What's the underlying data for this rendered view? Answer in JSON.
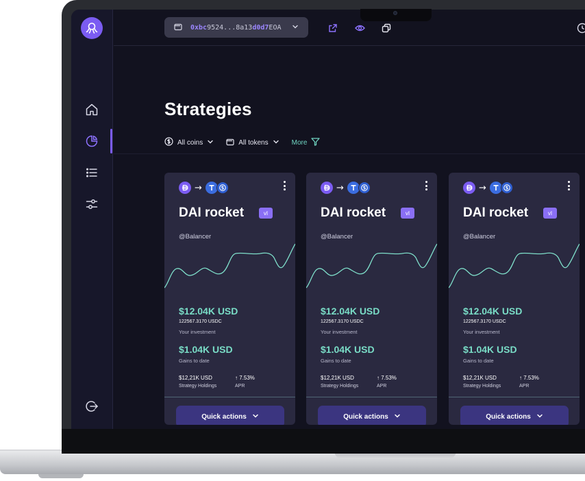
{
  "wallet": {
    "address_prefix": "0xbc",
    "address_middle": "9524...8a13",
    "address_accent": "d0d7",
    "address_suffix": "EOA"
  },
  "page": {
    "title": "Strategies"
  },
  "filters": {
    "coins_label": "All coins",
    "tokens_label": "All tokens",
    "more_label": "More"
  },
  "cards": [
    {
      "title": "DAI rocket",
      "version": "vI",
      "handle": "@Balancer",
      "investment_usd": "$12.04K USD",
      "investment_usdc": "122567.3170 USDC",
      "investment_label": "Your investment",
      "gains_usd": "$1.04K USD",
      "gains_label": "Gains to date",
      "holdings_value": "$12,21K USD",
      "holdings_label": "Strategy Holdings",
      "apr_value": "↑ 7.53%",
      "apr_label": "APR",
      "action_label": "Quick actions"
    },
    {
      "title": "DAI rocket",
      "version": "vI",
      "handle": "@Balancer",
      "investment_usd": "$12.04K USD",
      "investment_usdc": "122567.3170 USDC",
      "investment_label": "Your investment",
      "gains_usd": "$1.04K USD",
      "gains_label": "Gains to date",
      "holdings_value": "$12,21K USD",
      "holdings_label": "Strategy Holdings",
      "apr_value": "↑ 7.53%",
      "apr_label": "APR",
      "action_label": "Quick actions"
    },
    {
      "title": "DAI rocket",
      "version": "vI",
      "handle": "@Balancer",
      "investment_usd": "$12.04K USD",
      "investment_usdc": "122567.3170 USDC",
      "investment_label": "Your investment",
      "gains_usd": "$1.04K USD",
      "gains_label": "Gains to date",
      "holdings_value": "$12,21K USD",
      "holdings_label": "Strategy Holdings",
      "apr_value": "↑ 7.53%",
      "apr_label": "APR",
      "action_label": "Quick actions"
    }
  ],
  "icons": {
    "logo": "octopus-logo-icon",
    "wallet": "wallet-icon",
    "external_link": "external-link-icon",
    "eye": "eye-icon",
    "copy": "copy-icon",
    "home": "home-icon",
    "pie": "pie-chart-icon",
    "list": "list-icon",
    "settings": "sliders-icon",
    "logout": "logout-icon",
    "dollar": "dollar-circle-icon",
    "filter": "filter-icon"
  },
  "colors": {
    "accent": "#7b5cf2",
    "teal": "#79dcc6",
    "background": "#12121f",
    "card": "#2a2940",
    "button": "#3b3580"
  }
}
